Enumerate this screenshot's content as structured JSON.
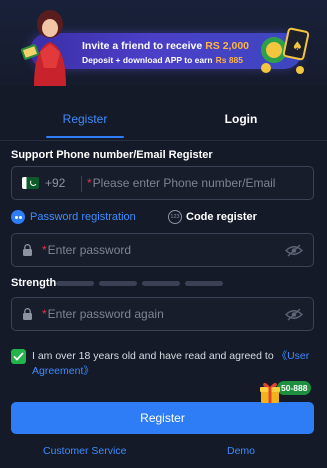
{
  "banner": {
    "line1_text": "Invite a friend to receive",
    "line1_amount": "RS 2,000",
    "line2_text": "Deposit + download APP to earn",
    "line2_amount": "Rs 885"
  },
  "tabs": [
    {
      "label": "Register",
      "active": true
    },
    {
      "label": "Login",
      "active": false
    }
  ],
  "form": {
    "section_title": "Support Phone number/Email Register",
    "phone_prefix": "+92",
    "phone_placeholder": "Please enter Phone number/Email",
    "required_mark": "*",
    "option_password": "Password registration",
    "option_code_icon": "123",
    "option_code": "Code register",
    "password_placeholder": "Enter password",
    "strength_label": "Strength",
    "password_again_placeholder": "Enter password again",
    "agree_text": "I am over 18 years old and have read and agreed to",
    "agree_link": "《User Agreement》",
    "agree_checked": true,
    "register_button": "Register",
    "gift_badge": "50-888"
  },
  "footer": {
    "customer_service": "Customer Service",
    "demo": "Demo"
  },
  "colors": {
    "background": "#141a27",
    "accent": "#2f7df6",
    "required": "#e1364b",
    "checkbox": "#25b34b"
  },
  "icons": [
    "pakistan-flag-icon",
    "lock-icon",
    "eye-off-icon",
    "checkmark-icon",
    "gift-icon",
    "radio-icon",
    "code-icon"
  ]
}
